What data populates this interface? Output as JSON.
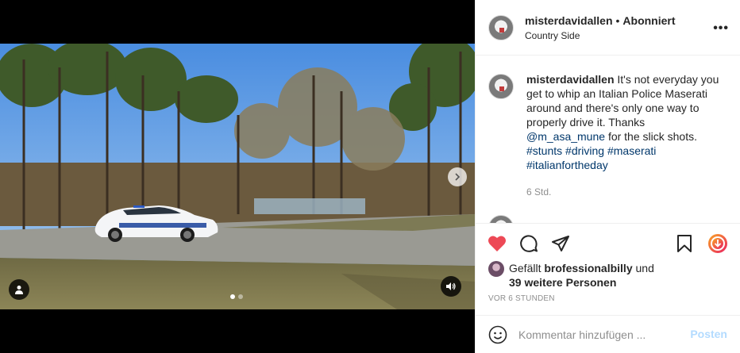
{
  "post": {
    "username": "misterdavidallen",
    "separator": "•",
    "follow_status": "Abonniert",
    "location": "Country Side",
    "more_label": "•••"
  },
  "caption": {
    "username": "misterdavidallen",
    "text": "It's not everyday you get to whip an Italian Police Maserati around and there's only one way to properly drive it. Thanks",
    "mention": "@m_asa_mune",
    "text_after": "for the slick shots.",
    "hashtags": [
      "#stunts",
      "#driving",
      "#maserati",
      "#italianfortheday"
    ],
    "time": "6 Std."
  },
  "likes": {
    "prefix": "Gefällt",
    "user": "brofessionalbilly",
    "joiner": "und",
    "others": "39 weitere Personen"
  },
  "date": "VOR 6 STUNDEN",
  "composer": {
    "placeholder": "Kommentar hinzufügen ...",
    "post_label": "Posten"
  },
  "media": {
    "carousel_count": 2,
    "carousel_active": 0
  },
  "colors": {
    "like_red": "#ed4956",
    "link_blue": "#00376b",
    "post_disabled": "#b3dbff",
    "reel_gradient": [
      "#f9a825",
      "#e91e63"
    ]
  },
  "icons": [
    "next-arrow-icon",
    "user-tag-icon",
    "speaker-icon",
    "heart-icon",
    "comment-icon",
    "share-icon",
    "bookmark-icon",
    "download-icon",
    "emoji-icon"
  ]
}
